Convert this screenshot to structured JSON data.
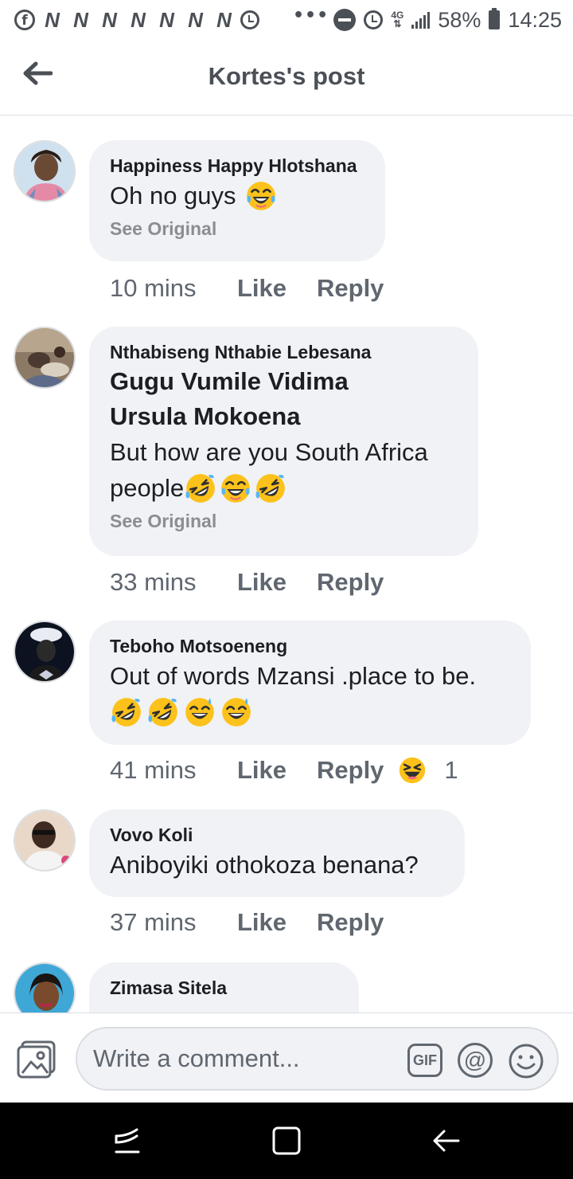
{
  "status_bar": {
    "notif_letters": [
      "N",
      "N",
      "N",
      "N",
      "N",
      "N",
      "N"
    ],
    "overflow": "•••",
    "network_top": "4G",
    "network_bottom": "⇅",
    "battery": "58%",
    "time": "14:25"
  },
  "header": {
    "title": "Kortes's post"
  },
  "comments": [
    {
      "author": "Happiness Happy Hlotshana",
      "text": "Oh no guys",
      "emojis": [
        "tears-of-joy"
      ],
      "see_original": "See Original",
      "time": "10 mins",
      "like": "Like",
      "reply": "Reply"
    },
    {
      "author": "Nthabiseng Nthabie Lebesana",
      "mentions": [
        "Gugu Vumile Vidima",
        "Ursula Mokoena"
      ],
      "text_line1": "But how are you South Africa",
      "text_line2": "people",
      "emojis": [
        "rolling-laughing",
        "tears-of-joy",
        "rolling-laughing"
      ],
      "see_original": "See Original",
      "time": "33 mins",
      "like": "Like",
      "reply": "Reply"
    },
    {
      "author": "Teboho Motsoeneng",
      "text": "Out of words Mzansi .place to be.",
      "emojis": [
        "rolling-laughing",
        "rolling-laughing",
        "grinning-sweat",
        "grinning-sweat"
      ],
      "time": "41 mins",
      "like": "Like",
      "reply": "Reply",
      "reaction": "haha",
      "reaction_count": "1"
    },
    {
      "author": "Vovo Koli",
      "text": "Aniboyiki othokoza benana?",
      "time": "37 mins",
      "like": "Like",
      "reply": "Reply"
    },
    {
      "author": "Zimasa Sitela"
    }
  ],
  "composer": {
    "placeholder": "Write a comment...",
    "gif_label": "GIF",
    "at_label": "@"
  },
  "colors": {
    "bubble": "#f0f2f5",
    "secondary_text": "#606770",
    "header_text": "#4b4f56",
    "emoji_yellow": "#fcc21b"
  }
}
